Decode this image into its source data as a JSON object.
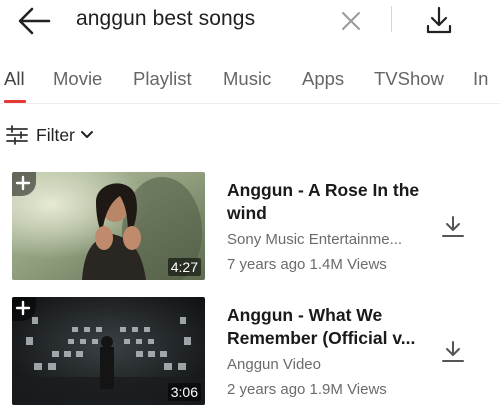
{
  "search": {
    "query": "anggun best songs",
    "back_icon": "arrow-left-icon",
    "clear_icon": "close-icon",
    "download_icon": "download-icon"
  },
  "tabs": [
    {
      "label": "All",
      "active": true
    },
    {
      "label": "Movie",
      "active": false
    },
    {
      "label": "Playlist",
      "active": false
    },
    {
      "label": "Music",
      "active": false
    },
    {
      "label": "Apps",
      "active": false
    },
    {
      "label": "TVShow",
      "active": false
    },
    {
      "label": "In",
      "active": false
    }
  ],
  "filter": {
    "label": "Filter"
  },
  "videos": [
    {
      "title": "Anggun - A Rose In the wind",
      "channel": "Sony Music Entertainme...",
      "meta": "7 years ago 1.4M Views",
      "duration": "4:27"
    },
    {
      "title": "Anggun - What We Remember (Official v...",
      "channel": "Anggun Video",
      "meta": "2 years ago 1.9M Views",
      "duration": "3:06"
    }
  ],
  "colors": {
    "accent": "#e53935",
    "text_primary": "#1a1a1a",
    "text_secondary": "#6b6b6b"
  }
}
